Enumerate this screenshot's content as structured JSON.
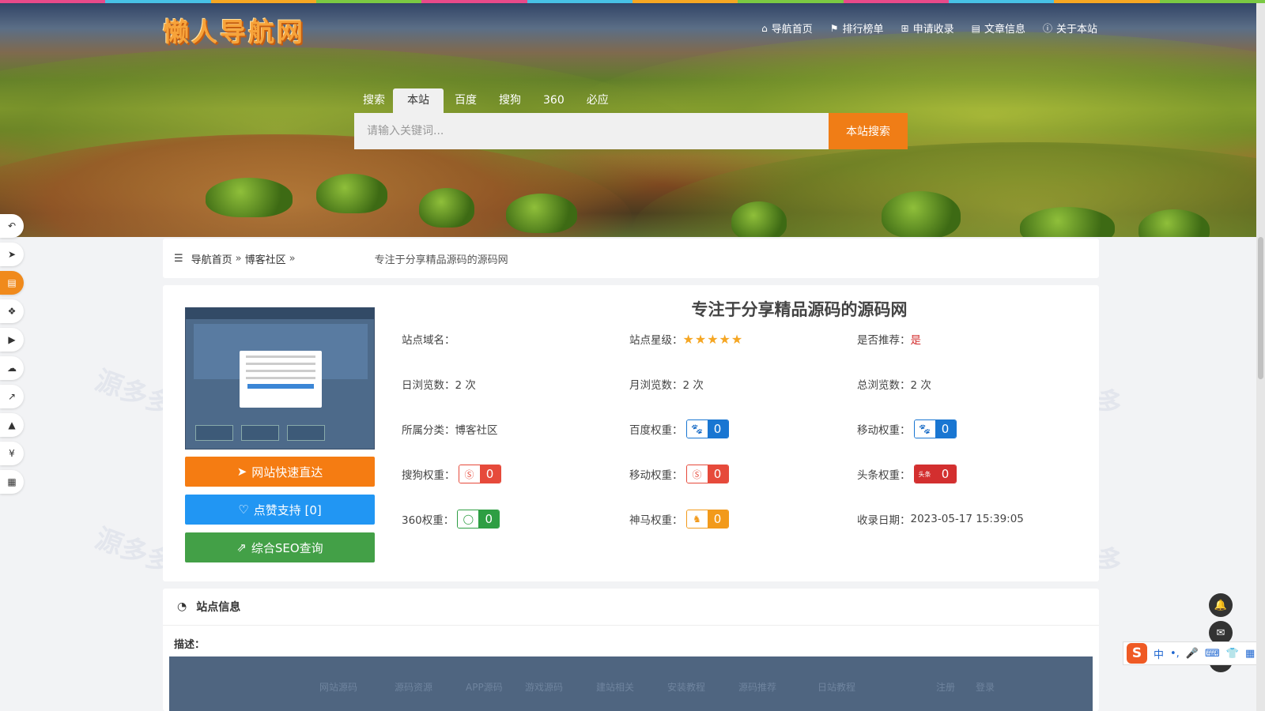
{
  "logo": "懒人导航网",
  "colors": {
    "accent": "#f07d16",
    "blue_button": "#2196f3",
    "green_button": "#43a047",
    "recommend_red": "#d32f2f"
  },
  "top_strip_colors": [
    "#e84a8a",
    "#47c1e6",
    "#f5a623",
    "#7ac943",
    "#e84a8a",
    "#47c1e6",
    "#f5a623",
    "#7ac943",
    "#e84a8a",
    "#47c1e6",
    "#f5a623",
    "#7ac943"
  ],
  "topnav": [
    {
      "icon": "home-icon",
      "label": "导航首页"
    },
    {
      "icon": "flag-icon",
      "label": "排行榜单"
    },
    {
      "icon": "plus-square-icon",
      "label": "申请收录"
    },
    {
      "icon": "book-icon",
      "label": "文章信息"
    },
    {
      "icon": "info-icon",
      "label": "关于本站"
    }
  ],
  "search": {
    "tabs_label": "搜索",
    "tabs": [
      "本站",
      "百度",
      "搜狗",
      "360",
      "必应"
    ],
    "active_tab": "本站",
    "placeholder": "请输入关键词...",
    "button": "本站搜索"
  },
  "leftbar": [
    {
      "icon": "reply-icon"
    },
    {
      "icon": "paper-plane-icon"
    },
    {
      "icon": "file-icon",
      "active": true
    },
    {
      "icon": "cubes-icon"
    },
    {
      "icon": "youtube-icon"
    },
    {
      "icon": "cloud-icon"
    },
    {
      "icon": "line-chart-icon"
    },
    {
      "icon": "graduation-cap-icon"
    },
    {
      "icon": "yen-icon"
    },
    {
      "icon": "grid-icon"
    }
  ],
  "breadcrumb": {
    "home": "导航首页",
    "category": "博客社区",
    "separator": "»",
    "current": "专注于分享精品源码的源码网"
  },
  "site": {
    "title": "专注于分享精品源码的源码网",
    "buttons": {
      "visit": "网站快速直达",
      "like": "点赞支持 [0]",
      "seo": "综合SEO查询"
    },
    "domain_label": "站点域名：",
    "domain_value": "",
    "rating_label": "站点星级：",
    "rating_stars": 5,
    "recommend_label": "是否推荐：",
    "recommend_value": "是",
    "daily_label": "日浏览数：",
    "daily_value": "2 次",
    "monthly_label": "月浏览数：",
    "monthly_value": "2 次",
    "total_label": "总浏览数：",
    "total_value": "2 次",
    "category_label": "所属分类：",
    "category_value": "博客社区",
    "baidu_label": "百度权重：",
    "baidu_value": "0",
    "mobile_label": "移动权重：",
    "mobile_value": "0",
    "sogou_label": "搜狗权重：",
    "sogou_value": "0",
    "sogou_mobile_label": "移动权重：",
    "sogou_mobile_value": "0",
    "toutiao_label": "头条权重：",
    "toutiao_value": "0",
    "toutiao_icon_text": "头条",
    "s360_label": "360权重：",
    "s360_value": "0",
    "shenma_label": "神马权重：",
    "shenma_value": "0",
    "date_label": "收录日期：",
    "date_value": "2023-05-17 15:39:05"
  },
  "station": {
    "title": "站点信息",
    "desc_label": "描述：",
    "preview_nav": [
      "网站源码",
      "源码资源",
      "APP源码",
      "游戏源码",
      "建站相关",
      "安装教程",
      "源码推荐",
      "日站教程",
      "注册",
      "登录"
    ]
  },
  "ime": {
    "logo": "S",
    "items": [
      "中",
      "•,",
      "mic-icon",
      "keyboard-icon",
      "shirt-icon",
      "grid-icon"
    ]
  },
  "watermark": "源多多"
}
